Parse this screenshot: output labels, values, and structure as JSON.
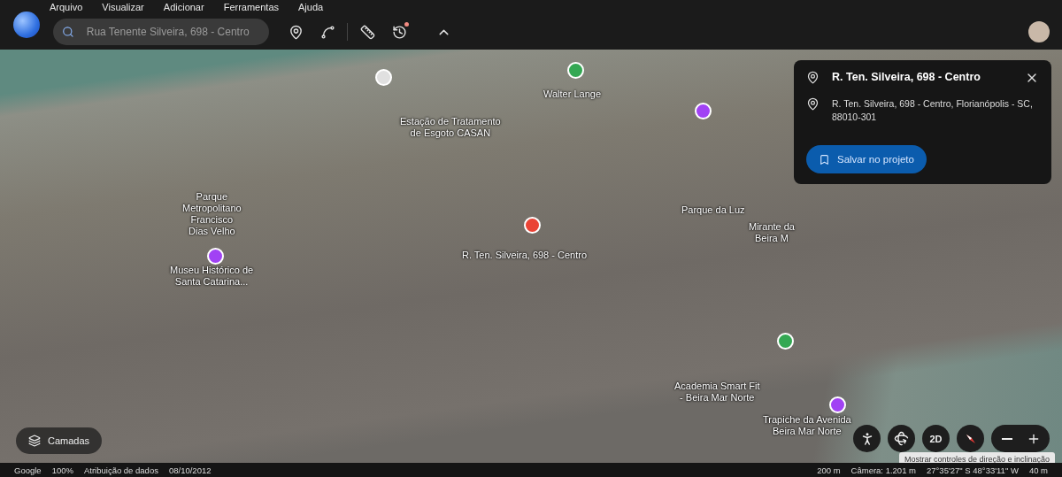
{
  "menu": [
    "Arquivo",
    "Visualizar",
    "Adicionar",
    "Ferramentas",
    "Ajuda"
  ],
  "search": {
    "value": "Rua Tenente Silveira, 698 - Centro"
  },
  "toolbar": {
    "notification": true
  },
  "map_labels": [
    "Walter Lange",
    "Estação de Tratamento\nde Esgoto CASAN",
    "Parque\nMetropolitano\nFrancisco\nDias Velho",
    "Museu Histórico de\nSanta Catarina...",
    "R. Ten. Silveira, 698 - Centro",
    "Parque da Luz",
    "Mirante da\nBeira M",
    "Academia Smart Fit\n- Beira Mar Norte",
    "Trapiche da Avenida\nBeira Mar Norte"
  ],
  "map_pins": [
    {
      "color": "#34a853"
    },
    {
      "color": "#e0e0e0"
    },
    {
      "color": "#a142f4"
    },
    {
      "color": "#a142f4"
    },
    {
      "color": "#ea4335"
    },
    {
      "color": "#34a853"
    },
    {
      "color": "#a142f4"
    }
  ],
  "place_card": {
    "title": "R. Ten. Silveira, 698 - Centro",
    "address": "R. Ten. Silveira, 698 - Centro, Florianópolis - SC, 88010-301",
    "save_button": "Salvar no projeto"
  },
  "layers_button": "Camadas",
  "map_controls": {
    "view_button": "2D"
  },
  "tooltip": "Mostrar controles de direção e inclinação",
  "status_bar": {
    "brand": "Google",
    "loading": "100%",
    "attribution": "Atribuição de dados",
    "date": "08/10/2012",
    "scale": "200 m",
    "camera": "Câmera: 1.201 m",
    "coordinates": "27°35'27\" S 48°33'11\" W",
    "elevation": "40 m"
  }
}
